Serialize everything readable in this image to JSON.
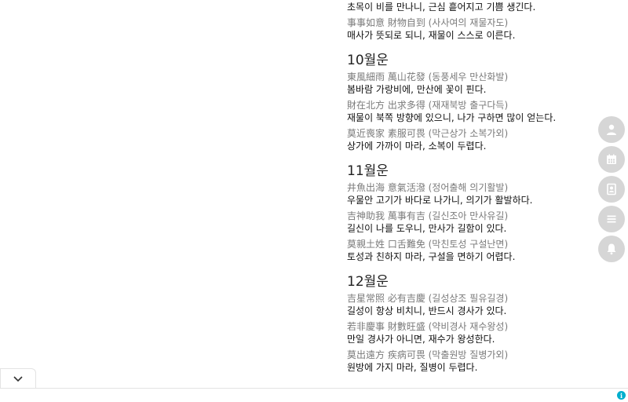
{
  "top_meaning": "초목이 비를 만나니, 근심 흩어지고 기쁨 생긴다.",
  "top_group": {
    "proverb": "事事如意 財物自到 (사사여의 재물자도)",
    "meaning": "매사가 뜻되로 되니, 재물이 스스로 이른다."
  },
  "months": [
    {
      "title": "10월운",
      "items": [
        {
          "proverb": "東風細雨 萬山花發 (동풍세우 만산화발)",
          "meaning": "봄바람 가랑비에, 만산에 꽃이 핀다."
        },
        {
          "proverb": "財在北方 出求多得 (재재북방 출구다득)",
          "meaning": "재물이 북쪽 방향에 있으니, 나가 구하면 많이 얻는다."
        },
        {
          "proverb": "莫近喪家 素服可畏 (막근상가 소복가외)",
          "meaning": "상가에 가까이 마라, 소복이 두렵다."
        }
      ]
    },
    {
      "title": "11월운",
      "items": [
        {
          "proverb": "井魚出海 意氣活潑 (정어출해 의기활발)",
          "meaning": "우물안 고기가 바다로 나가니, 의기가 활발하다."
        },
        {
          "proverb": "吉神助我 萬事有吉 (길신조아 만사유길)",
          "meaning": "길신이 나를 도우니, 만사가 길함이 있다."
        },
        {
          "proverb": "莫親土姓 口舌難免 (막친토성 구설난면)",
          "meaning": "토성과 친하지 마라, 구설을 면하기 어렵다."
        }
      ]
    },
    {
      "title": "12월운",
      "items": [
        {
          "proverb": "吉星常照 必有吉慶 (길성상조 필유길경)",
          "meaning": "길성이 항상 비치니, 반드시 경사가 있다."
        },
        {
          "proverb": "若非慶事 財數旺盛 (약비경사 재수왕성)",
          "meaning": "만일 경사가 아니면, 재수가 왕성한다."
        },
        {
          "proverb": "莫出遠方 疾病可畏 (막출원방 질병가외)",
          "meaning": "원방에 가지 마라, 질병이 두렵다."
        }
      ]
    }
  ],
  "side_buttons": [
    {
      "icon": "person-icon"
    },
    {
      "icon": "calendar-icon"
    },
    {
      "icon": "contact-card-icon"
    },
    {
      "icon": "menu-icon"
    },
    {
      "icon": "bell-icon"
    }
  ],
  "ad_bar": {
    "collapse_icon": "chevron-down-icon",
    "adchoices_glyph": "i"
  },
  "colors": {
    "button_bg": "#d6d6d6",
    "proverb_text": "#7a7a7a",
    "adchoices": "#00aecd"
  }
}
